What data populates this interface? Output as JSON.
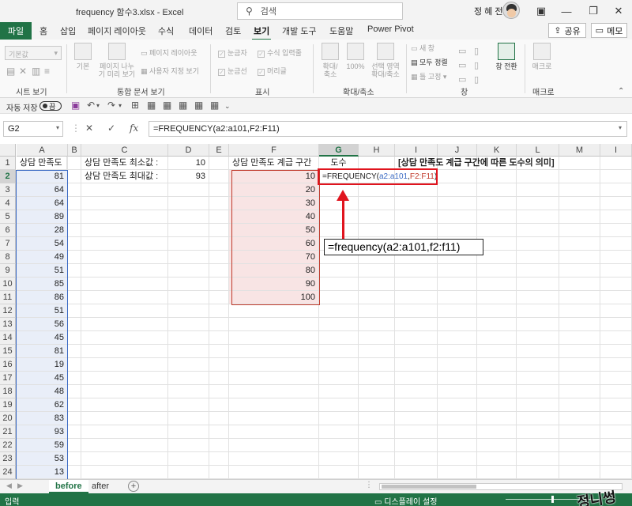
{
  "window": {
    "title": "frequency 함수3.xlsx  -  Excel",
    "search_placeholder": "검색",
    "user_name": "정 혜 전"
  },
  "tabs": [
    "파일",
    "홈",
    "삽입",
    "페이지 레이아웃",
    "수식",
    "데이터",
    "검토",
    "보기",
    "개발 도구",
    "도움말",
    "Power Pivot"
  ],
  "active_tab": "보기",
  "share_label": "공유",
  "memo_label": "메모",
  "ribbon": {
    "style_combo": "기본값",
    "groups": {
      "sheet_view": "시트 보기",
      "workbook_views": "통합 문서 보기",
      "show": "표시",
      "zoom": "확대/축소",
      "window": "창",
      "macros": "매크로"
    },
    "buttons": {
      "normal": "기본",
      "page_break": "페이지 나누\n기 미리 보기",
      "page_layout": "페이지 레이아웃",
      "custom_views": "사용자 지정 보기",
      "ruler": "눈금자",
      "formula_bar": "수식 입력줄",
      "gridlines": "눈금선",
      "headings": "머리글",
      "zoom": "확대/\n축소",
      "zoom100": "100%",
      "zoom_selection": "선택 영역\n확대/축소",
      "new_window": "새 창",
      "arrange_all": "모두 정렬",
      "freeze_panes": "틀 고정",
      "switch_windows": "창 전환",
      "macros": "매크로"
    }
  },
  "qat": {
    "autosave_label": "자동 저장",
    "autosave_state": "끔"
  },
  "formula_bar": {
    "name_box": "G2",
    "formula": "=FREQUENCY(a2:a101,F2:F11)"
  },
  "columns": [
    "A",
    "B",
    "C",
    "D",
    "E",
    "F",
    "G",
    "H",
    "I",
    "J",
    "K",
    "L",
    "M",
    "I"
  ],
  "row_numbers": [
    "1",
    "2",
    "3",
    "4",
    "5",
    "6",
    "7",
    "8",
    "9",
    "10",
    "11",
    "12",
    "13",
    "14",
    "15",
    "16",
    "17",
    "18",
    "19",
    "20",
    "21",
    "22",
    "23",
    "24"
  ],
  "sheet": {
    "a1": "상담 만족도",
    "a_values": [
      "81",
      "64",
      "64",
      "89",
      "28",
      "54",
      "49",
      "51",
      "85",
      "86",
      "51",
      "56",
      "45",
      "81",
      "19",
      "45",
      "48",
      "62",
      "83",
      "93",
      "59",
      "53",
      "13"
    ],
    "c1": "상담 만족도 최소값 :",
    "d1": "10",
    "c2": "상담 만족도 최대값 :",
    "d2": "93",
    "f1": "상담 만족도 계급 구간",
    "f_values": [
      "10",
      "20",
      "30",
      "40",
      "50",
      "60",
      "70",
      "80",
      "90",
      "100"
    ],
    "g1": "도수",
    "g2_parts": {
      "prefix": "=FREQUENCY(",
      "range1": "a2:a101",
      "sep": ",",
      "range2": "F2:F11",
      "suffix": ")"
    },
    "i1": "[상담 만족도 계급 구간에 따른 도수의 의미]"
  },
  "annotation": {
    "callout": "=frequency(a2:a101,f2:f11)"
  },
  "sheet_tabs": [
    "before",
    "after"
  ],
  "active_sheet": "before",
  "status": {
    "mode": "입력",
    "display_settings": "디스플레이 설정",
    "signature": "정니썽"
  },
  "colors": {
    "excel_green": "#217346",
    "highlight_red": "#e0141e",
    "range_blue": "#3d6cc4",
    "range_red": "#c0392b",
    "pink_fill": "#f8e4e4",
    "blue_fill": "#e9eef8"
  }
}
